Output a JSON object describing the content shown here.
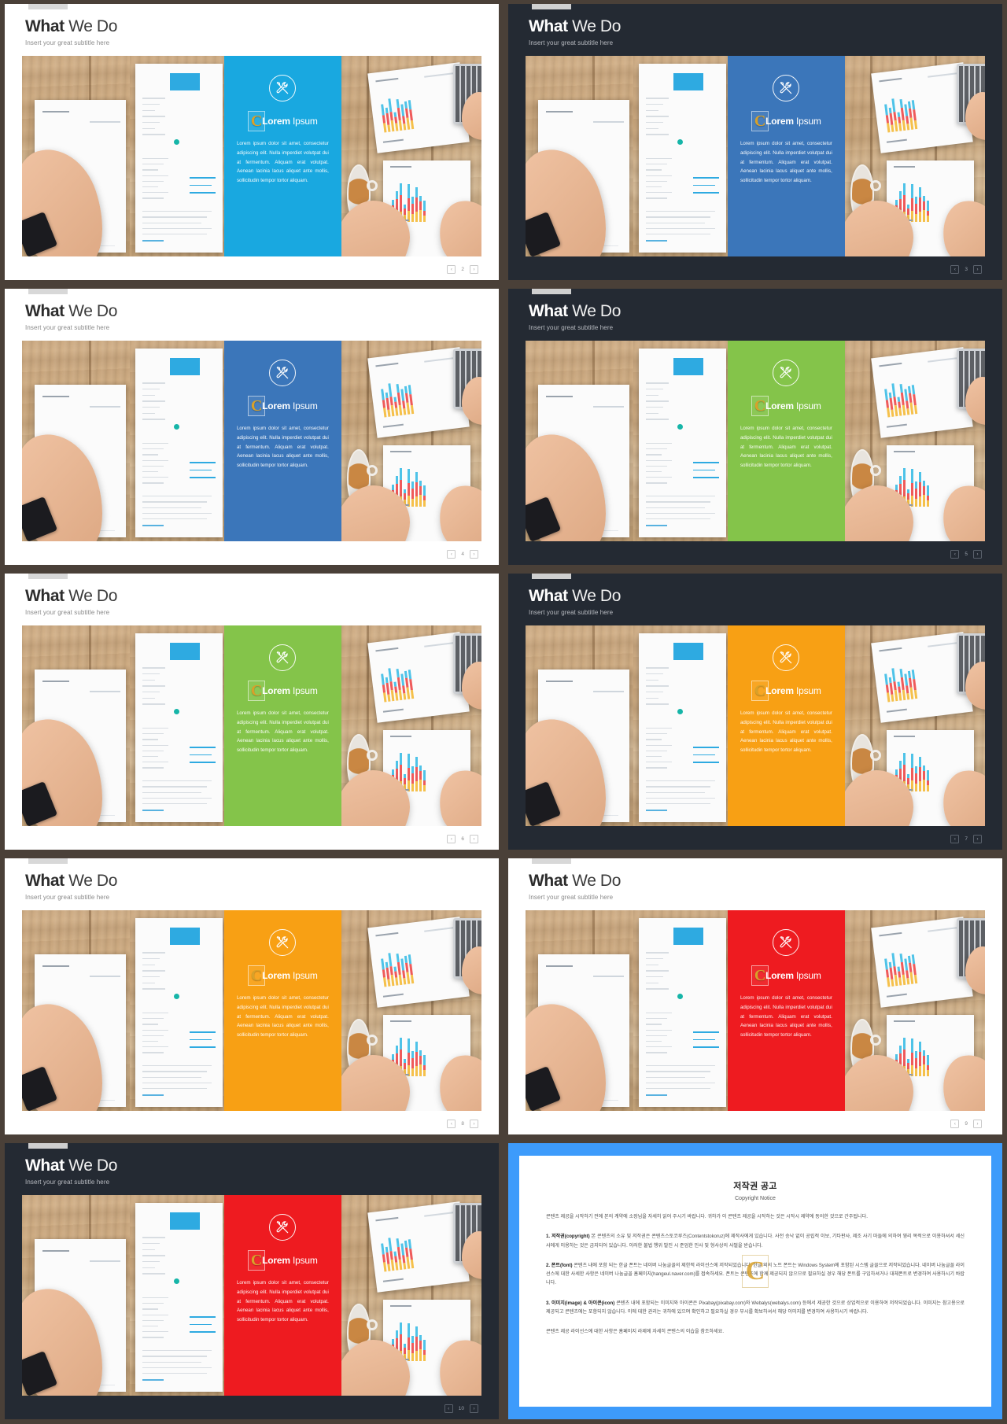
{
  "slides": [
    {
      "n": 1,
      "page": "2",
      "theme": "light",
      "accent": "#19a8e0",
      "title_bold": "What",
      "title_rest": " We Do",
      "subtitle": "Insert  your great subtitle here"
    },
    {
      "n": 2,
      "page": "3",
      "theme": "dark",
      "accent": "#3b76ba",
      "title_bold": "What",
      "title_rest": " We Do",
      "subtitle": "Insert  your great subtitle here"
    },
    {
      "n": 3,
      "page": "4",
      "theme": "light",
      "accent": "#3b76ba",
      "title_bold": "What",
      "title_rest": " We Do",
      "subtitle": "Insert  your great subtitle here"
    },
    {
      "n": 4,
      "page": "5",
      "theme": "dark",
      "accent": "#84c44a",
      "title_bold": "What",
      "title_rest": " We Do",
      "subtitle": "Insert  your great subtitle here"
    },
    {
      "n": 5,
      "page": "6",
      "theme": "light",
      "accent": "#84c44a",
      "title_bold": "What",
      "title_rest": " We Do",
      "subtitle": "Insert  your great subtitle here"
    },
    {
      "n": 6,
      "page": "7",
      "theme": "dark",
      "accent": "#f8a014",
      "title_bold": "What",
      "title_rest": " We Do",
      "subtitle": "Insert  your great subtitle here"
    },
    {
      "n": 7,
      "page": "8",
      "theme": "light",
      "accent": "#f8a014",
      "title_bold": "What",
      "title_rest": " We Do",
      "subtitle": "Insert  your great subtitle here"
    },
    {
      "n": 8,
      "page": "9",
      "theme": "light",
      "accent": "#ee1b20",
      "title_bold": "What",
      "title_rest": " We Do",
      "subtitle": "Insert  your great subtitle here"
    },
    {
      "n": 9,
      "page": "10",
      "theme": "dark",
      "accent": "#ee1b20",
      "title_bold": "What",
      "title_rest": " We Do",
      "subtitle": "Insert  your great subtitle here"
    }
  ],
  "common": {
    "logo_bold": "Lorem",
    "logo_light": " Ipsum",
    "logo_mark": "C",
    "body_text": "Lorem ipsum dolor sit amet, consectetur adipiscing elit. Nulla imperdiet volutpat dui at fermentum. Aliquam erat volutpat. Aenean lacinia lacus aliquet ante mollis, sollicitudin tempor tortor aliquam.",
    "nav_prev": "‹",
    "nav_next": "›",
    "tool_icon": "wrench-screwdriver-icon"
  },
  "copyright": {
    "title_ko": "저작권 공고",
    "title_en": "Copyright Notice",
    "intro": "콘텐츠 제공을 시작하기 전에 본의 계약에 소장님을 자세히 읽어 주시기 바랍니다. 귀하가 이 콘텐츠 제공을 시작하는 것은 시작시 제약에 동의한 것으로 간주됩니다.",
    "items": [
      {
        "label": "1. 저작권(copyright)",
        "text": "본 콘텐츠의 소유 및 저작권은 콘텐츠스토코루즈(Contentstokoruz)에 제작사에게 있습니다. 사전 승낙 없이 공립적 이보, 기타판사, 제조 사기 마들에 의하여 영리 목적으로 이용하셔서 세신사에게 이용하는 것은 금지되어 있습니다. 이러한 불법 행위 발진 시 준엄한 민사 및 형사상의 사벌을 받습니다."
      },
      {
        "label": "2. 폰트(font)",
        "text": "콘텐츠 내에 포함 되는 한글 폰트는 네이버 나눔글꼴의 제한적 라이선스에 저작되었습니다. 한글 외의 노트 폰트는 Windows System에 포함된 시스템 글꼴으로 저작되었습니다. 네이버 나눔글꼴 라이선스에 대한 사세한 사항은 네이버 나눔글꼴 홈페이지(hangeul.naver.com)를 접속하세요. 폰트는 콘텐츠에 함께 제공되지 않으므로 필요하실 경우 해당 폰트를 구입하셔거나 대체폰트로 변경하여 사용하시기 바랍니다."
      },
      {
        "label": "3. 이미지(image) & 아이콘(icon)",
        "text": "콘텐츠 내에 포함되는 이미지와 아이콘은 Pixabay(pixabay.com)와 Webalys(webalys.com) 등에서 제공한 것으로 상업적으로 이용하여 저작되었습니다. 이미지는 참고용으로 제공되고 콘텐츠에는 포함되지 않습니다. 이에 대한 권리는 귀하에 있으며 확인하고 필요하실 경우 부시를 확보하셔서 해당 이미지를 변경하여 사용하시기 바랍니다."
      }
    ],
    "outro": "콘텐츠 제공 라이선스에 대한 사항은 홈페이지 라제에 자세히 콘텐스의 이습을 참조하세요.",
    "watermark": "C"
  }
}
